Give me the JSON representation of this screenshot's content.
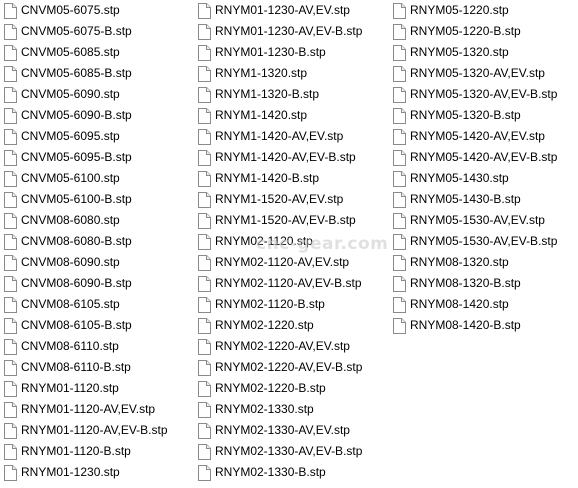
{
  "files": {
    "column1": [
      "CNVM05-6075.stp",
      "CNVM05-6075-B.stp",
      "CNVM05-6085.stp",
      "CNVM05-6085-B.stp",
      "CNVM05-6090.stp",
      "CNVM05-6090-B.stp",
      "CNVM05-6095.stp",
      "CNVM05-6095-B.stp",
      "CNVM05-6100.stp",
      "CNVM05-6100-B.stp",
      "CNVM08-6080.stp",
      "CNVM08-6080-B.stp",
      "CNVM08-6090.stp",
      "CNVM08-6090-B.stp",
      "CNVM08-6105.stp",
      "CNVM08-6105-B.stp",
      "CNVM08-6110.stp",
      "CNVM08-6110-B.stp",
      "RNYM01-1120.stp",
      "RNYM01-1120-AV,EV.stp",
      "RNYM01-1120-AV,EV-B.stp",
      "RNYM01-1120-B.stp",
      "RNYM01-1230.stp"
    ],
    "column2": [
      "RNYM01-1230-AV,EV.stp",
      "RNYM01-1230-AV,EV-B.stp",
      "RNYM01-1230-B.stp",
      "RNYM1-1320.stp",
      "RNYM1-1320-B.stp",
      "RNYM1-1420.stp",
      "RNYM1-1420-AV,EV.stp",
      "RNYM1-1420-AV,EV-B.stp",
      "RNYM1-1420-B.stp",
      "RNYM1-1520-AV,EV.stp",
      "RNYM1-1520-AV,EV-B.stp",
      "RNYM02-1120.stp",
      "RNYM02-1120-AV,EV.stp",
      "RNYM02-1120-AV,EV-B.stp",
      "RNYM02-1120-B.stp",
      "RNYM02-1220.stp",
      "RNYM02-1220-AV,EV.stp",
      "RNYM02-1220-AV,EV-B.stp",
      "RNYM02-1220-B.stp",
      "RNYM02-1330.stp",
      "RNYM02-1330-AV,EV.stp",
      "RNYM02-1330-AV,EV-B.stp",
      "RNYM02-1330-B.stp"
    ],
    "column3": [
      "RNYM05-1220.stp",
      "RNYM05-1220-B.stp",
      "RNYM05-1320.stp",
      "RNYM05-1320-AV,EV.stp",
      "RNYM05-1320-AV,EV-B.stp",
      "RNYM05-1320-B.stp",
      "RNYM05-1420-AV,EV.stp",
      "RNYM05-1420-AV,EV-B.stp",
      "RNYM05-1430.stp",
      "RNYM05-1430-B.stp",
      "RNYM05-1530-AV,EV.stp",
      "RNYM05-1530-AV,EV-B.stp",
      "RNYM08-1320.stp",
      "RNYM08-1320-B.stp",
      "RNYM08-1420.stp",
      "RNYM08-1420-B.stp"
    ]
  },
  "icons": {
    "file": "generic-file-icon"
  },
  "watermark": "cnc-gear.com",
  "colors": {
    "background": "#ffffff",
    "text": "#000000",
    "icon_stroke": "#8a8a8a",
    "watermark": "#c8c8c8"
  }
}
